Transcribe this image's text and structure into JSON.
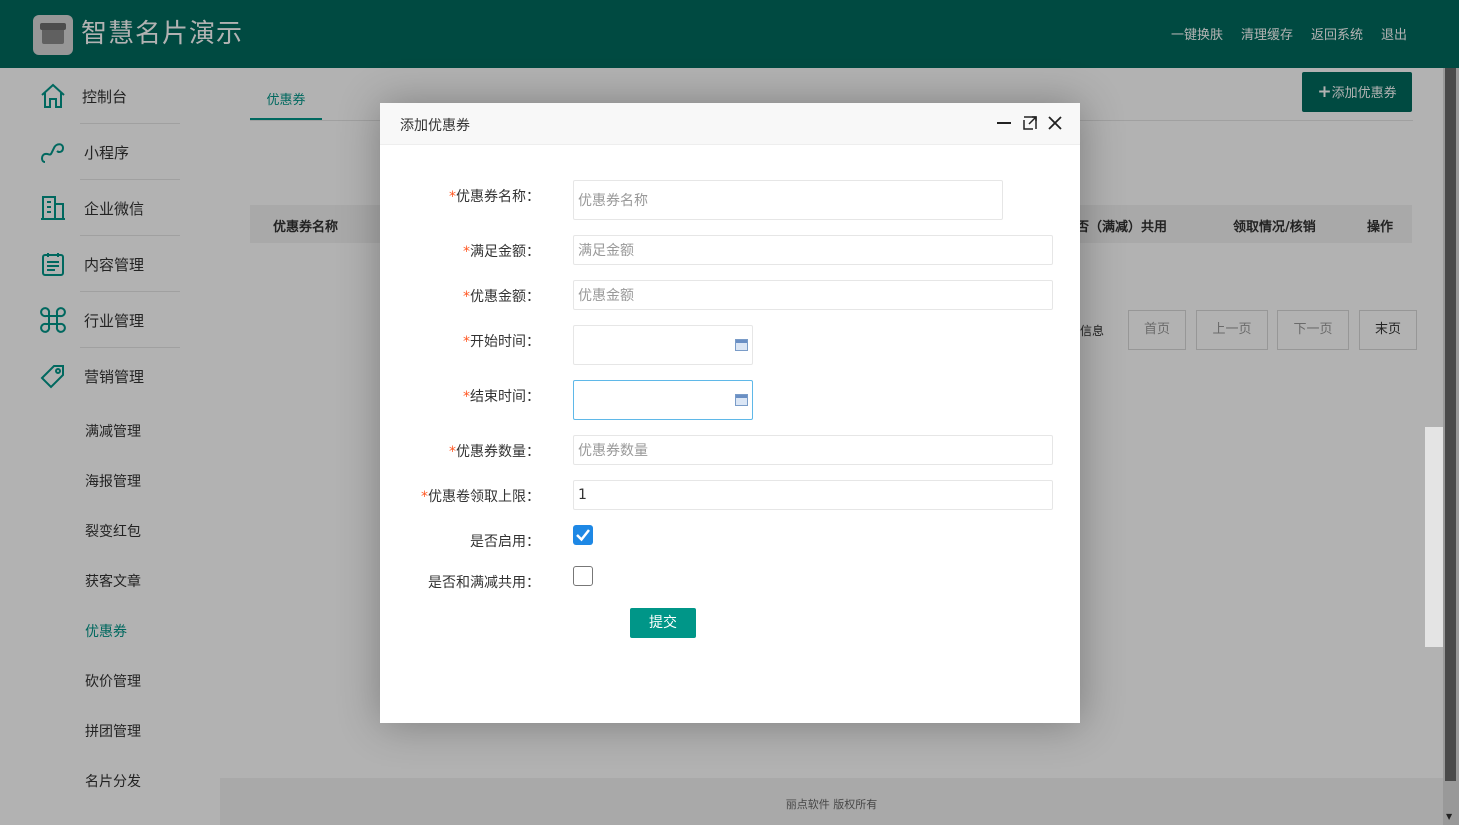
{
  "app": {
    "brand": "智慧名片演示",
    "top_nav": [
      "一键换肤",
      "清理缓存",
      "返回系统",
      "退出"
    ]
  },
  "sidebar": {
    "items": [
      {
        "label": "控制台",
        "icon": "home-icon"
      },
      {
        "label": "小程序",
        "icon": "miniprogram-icon"
      },
      {
        "label": "企业微信",
        "icon": "building-icon"
      },
      {
        "label": "内容管理",
        "icon": "clipboard-icon"
      },
      {
        "label": "行业管理",
        "icon": "command-icon"
      },
      {
        "label": "营销管理",
        "icon": "tag-icon"
      }
    ],
    "sub_items": [
      "满减管理",
      "海报管理",
      "裂变红包",
      "获客文章",
      "优惠券",
      "砍价管理",
      "拼团管理",
      "名片分发"
    ],
    "active_sub": "优惠券"
  },
  "main": {
    "tab": "优惠券",
    "add_button": "添加优惠券",
    "table_headers": [
      "优惠券名称",
      "否（满减）共用",
      "领取情况/核销",
      "操作"
    ],
    "page_info": "信息",
    "pager": [
      "首页",
      "上一页",
      "下一页",
      "末页"
    ]
  },
  "footer": "丽点软件 版权所有",
  "modal": {
    "title": "添加优惠券",
    "fields": {
      "name": {
        "label": "优惠券名称：",
        "placeholder": "优惠券名称"
      },
      "threshold": {
        "label": "满足金额：",
        "placeholder": "满足金额"
      },
      "discount": {
        "label": "优惠金额：",
        "placeholder": "优惠金额"
      },
      "start_time": {
        "label": "开始时间：",
        "value": ""
      },
      "end_time": {
        "label": "结束时间：",
        "value": ""
      },
      "quantity": {
        "label": "优惠券数量：",
        "placeholder": "优惠券数量"
      },
      "limit": {
        "label": "优惠卷领取上限：",
        "value": "1"
      },
      "enabled": {
        "label": "是否启用：",
        "checked": true
      },
      "share_with_discount": {
        "label": "是否和满减共用：",
        "checked": false
      }
    },
    "required_mark": "*",
    "submit": "提交"
  },
  "colors": {
    "header": "#006b5e",
    "accent": "#009688",
    "checkbox": "#1e88e5",
    "required": "#ff5722"
  }
}
